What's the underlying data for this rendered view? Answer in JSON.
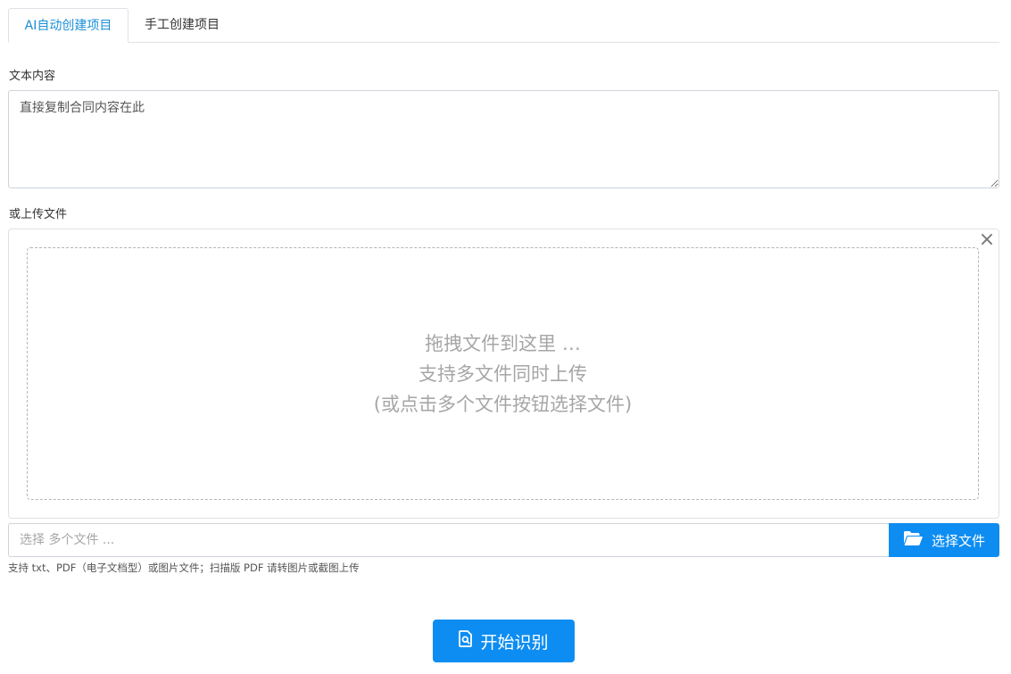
{
  "tabs": [
    {
      "label": "AI自动创建项目",
      "active": true
    },
    {
      "label": "手工创建项目",
      "active": false
    }
  ],
  "text_section": {
    "label": "文本内容",
    "placeholder": "直接复制合同内容在此"
  },
  "upload_section": {
    "label": "或上传文件",
    "close_symbol": "×",
    "dropzone_lines": [
      "拖拽文件到这里 …",
      "支持多文件同时上传",
      "(或点击多个文件按钮选择文件)"
    ],
    "caption_placeholder": "选择 多个文件 ...",
    "browse_label": "选择文件",
    "browse_icon": "folder-open-icon",
    "hint": "支持 txt、PDF（电子文档型）或图片文件；扫描版 PDF 请转图片或截图上传"
  },
  "submit": {
    "label": "开始识别",
    "icon": "file-search-icon"
  },
  "colors": {
    "accent": "#0d8df2",
    "tab_active": "#1a8fd6",
    "dropzone_text": "#a6a6a6"
  }
}
